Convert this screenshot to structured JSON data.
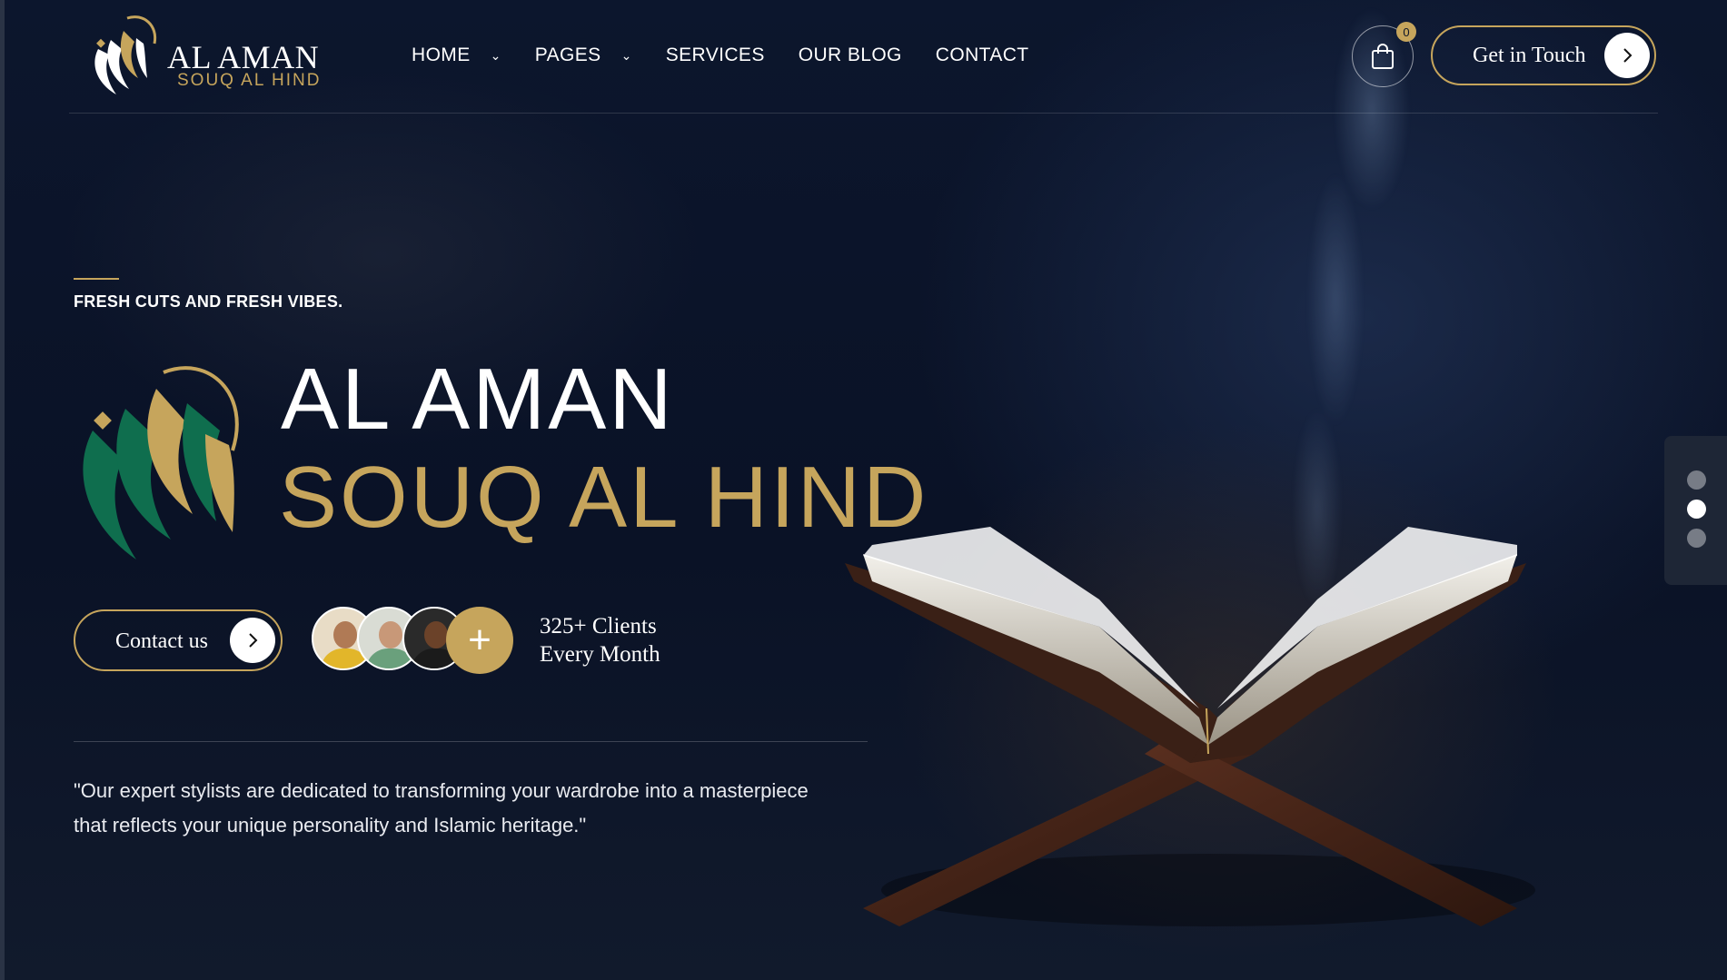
{
  "header": {
    "logo": {
      "title": "AL AMAN",
      "subtitle": "SOUQ AL HIND"
    },
    "nav": [
      {
        "label": "HOME",
        "has_dropdown": true
      },
      {
        "label": "PAGES",
        "has_dropdown": true
      },
      {
        "label": "SERVICES",
        "has_dropdown": false
      },
      {
        "label": "OUR BLOG",
        "has_dropdown": false
      },
      {
        "label": "CONTACT",
        "has_dropdown": false
      }
    ],
    "cart": {
      "count": "0",
      "icon": "shopping-bag-icon"
    },
    "cta": {
      "label": "Get in Touch",
      "icon": "chevron-right-icon"
    }
  },
  "hero": {
    "tagline": "FRESH CUTS AND FRESH VIBES.",
    "title_line1": "AL AMAN",
    "title_line2": "SOUQ AL HIND",
    "contact_button": {
      "label": "Contact us",
      "icon": "chevron-right-icon"
    },
    "clients": {
      "line1": "325+ Clients",
      "line2": "Every Month",
      "plus_icon": "+"
    },
    "quote": "\"Our expert stylists are dedicated to transforming your wardrobe into a masterpiece that reflects your unique personality and Islamic heritage.\""
  },
  "slider": {
    "slides": 3,
    "active_index": 1
  },
  "colors": {
    "accent_gold": "#c6a55c",
    "emblem_green": "#0f6e4e",
    "background_navy": "#0b1428"
  }
}
